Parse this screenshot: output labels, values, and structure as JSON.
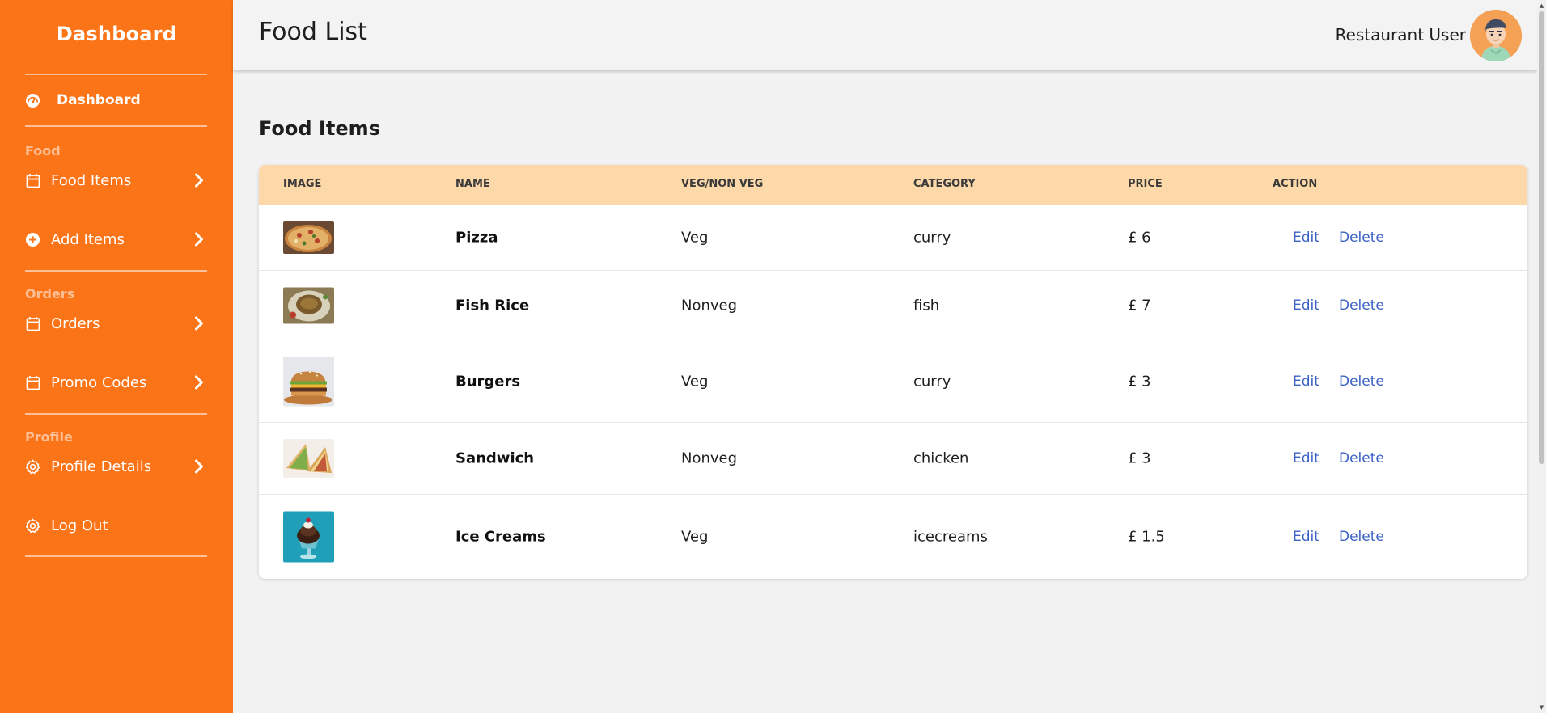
{
  "sidebar": {
    "brand": "Dashboard",
    "dashboard_label": "Dashboard",
    "sections": {
      "food": "Food",
      "orders": "Orders",
      "profile": "Profile"
    },
    "items": {
      "food_items": "Food Items",
      "add_items": "Add Items",
      "orders": "Orders",
      "promo_codes": "Promo Codes",
      "profile_details": "Profile Details",
      "log_out": "Log Out"
    }
  },
  "header": {
    "title": "Food List",
    "user_name": "Restaurant User"
  },
  "main": {
    "section_title": "Food Items",
    "columns": [
      "IMAGE",
      "NAME",
      "VEG/NON VEG",
      "CATEGORY",
      "PRICE",
      "ACTION"
    ],
    "rows": [
      {
        "image": "pizza",
        "name": "Pizza",
        "type": "Veg",
        "category": "curry",
        "price": "£ 6",
        "edit": "Edit",
        "delete": "Delete"
      },
      {
        "image": "fish-rice",
        "name": "Fish Rice",
        "type": "Nonveg",
        "category": "fish",
        "price": "£ 7",
        "edit": "Edit",
        "delete": "Delete"
      },
      {
        "image": "burger",
        "name": "Burgers",
        "type": "Veg",
        "category": "curry",
        "price": "£ 3",
        "edit": "Edit",
        "delete": "Delete"
      },
      {
        "image": "sandwich",
        "name": "Sandwich",
        "type": "Nonveg",
        "category": "chicken",
        "price": "£ 3",
        "edit": "Edit",
        "delete": "Delete"
      },
      {
        "image": "ice-cream",
        "name": "Ice Creams",
        "type": "Veg",
        "category": "icecreams",
        "price": "£ 1.5",
        "edit": "Edit",
        "delete": "Delete"
      }
    ]
  },
  "colors": {
    "sidebar_bg": "#fb7418",
    "table_header_bg": "#fdd8a8",
    "link": "#3b62c4",
    "page_bg": "#f3f2f3"
  }
}
